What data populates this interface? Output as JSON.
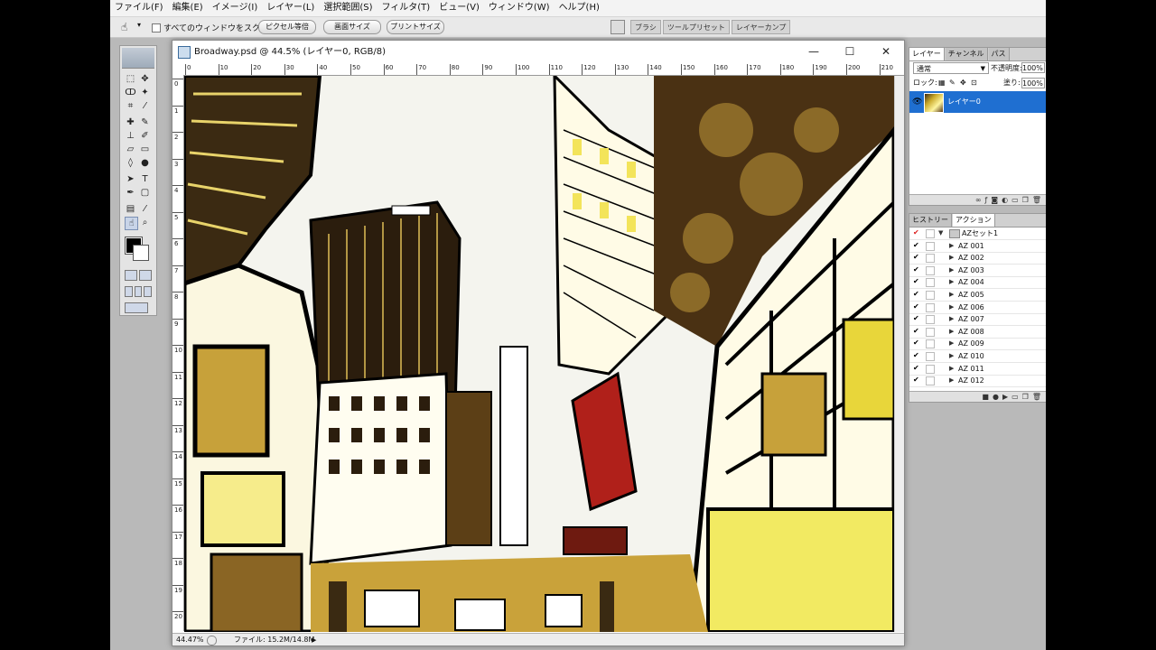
{
  "menu": [
    "ファイル(F)",
    "編集(E)",
    "イメージ(I)",
    "レイヤー(L)",
    "選択範囲(S)",
    "フィルタ(T)",
    "ビュー(V)",
    "ウィンドウ(W)",
    "ヘルプ(H)"
  ],
  "options": {
    "scroll_all_label": "すべてのウィンドウをスクロール",
    "actual_pixels_label": "ピクセル等倍",
    "fit_screen_label": "画面サイズ",
    "print_size_label": "プリントサイズ"
  },
  "dock_tabs": [
    "ブラシ",
    "ツールプリセット",
    "レイヤーカンプ"
  ],
  "document": {
    "title": "Broadway.psd @ 44.5% (レイヤー0, RGB/8)",
    "zoom": "44.47%",
    "file_info": "ファイル: 15.2M/14.8M",
    "ruler_top": [
      "0",
      "10",
      "20",
      "30",
      "40",
      "50",
      "60",
      "70",
      "80",
      "90",
      "100",
      "110",
      "120",
      "130",
      "140",
      "150",
      "160",
      "170",
      "180",
      "190",
      "200",
      "210"
    ],
    "ruler_left": [
      "0",
      "1",
      "2",
      "3",
      "4",
      "5",
      "6",
      "7",
      "8",
      "9",
      "10",
      "11",
      "12",
      "13",
      "14",
      "15",
      "16",
      "17",
      "18",
      "19",
      "20"
    ]
  },
  "layers_panel": {
    "tabs": [
      "レイヤー",
      "チャンネル",
      "パス"
    ],
    "blend_mode": "通常",
    "opacity_label": "不透明度:",
    "opacity_value": "100%",
    "lock_label": "ロック:",
    "fill_label": "塗り:",
    "fill_value": "100%",
    "layer_name": "レイヤー0"
  },
  "actions_panel": {
    "tabs": [
      "ヒストリー",
      "アクション"
    ],
    "set_name": "AZセット1",
    "items": [
      "AZ 001",
      "AZ 002",
      "AZ 003",
      "AZ 004",
      "AZ 005",
      "AZ 006",
      "AZ 007",
      "AZ 008",
      "AZ 009",
      "AZ 010",
      "AZ 011",
      "AZ 012"
    ]
  },
  "colors": {
    "selection_blue": "#1f6fd1",
    "workspace_gray": "#b9b9b9"
  }
}
